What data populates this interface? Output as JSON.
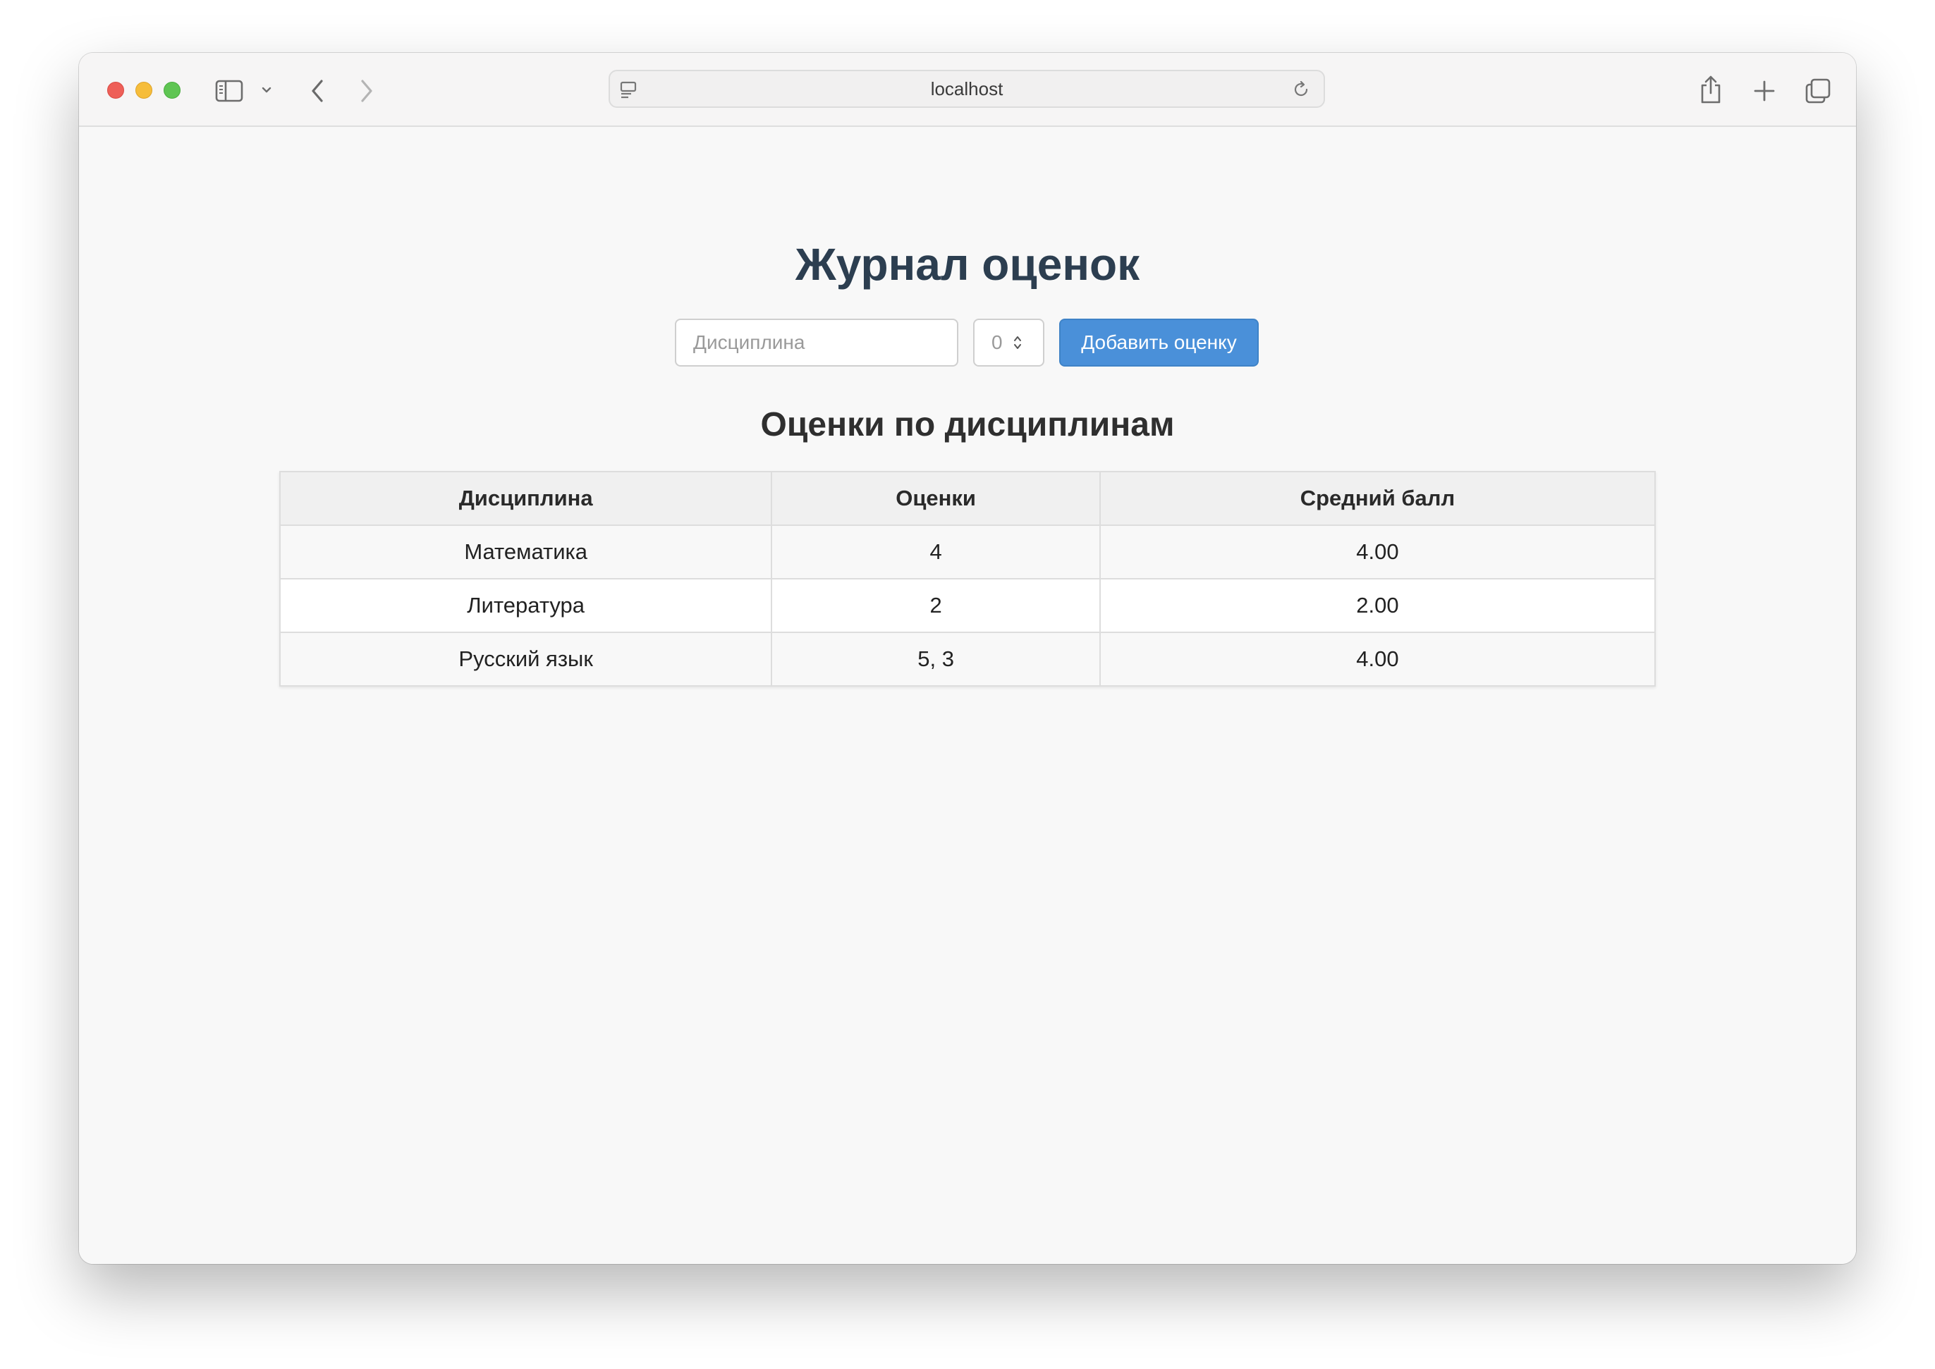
{
  "browser": {
    "address": "localhost"
  },
  "page": {
    "title": "Журнал оценок",
    "form": {
      "subject_placeholder": "Дисциплина",
      "grade_value": "0",
      "add_button_label": "Добавить оценку"
    },
    "section_title": "Оценки по дисциплинам",
    "table": {
      "headers": [
        "Дисциплина",
        "Оценки",
        "Средний балл"
      ],
      "rows": [
        {
          "subject": "Математика",
          "grades": "4",
          "average": "4.00"
        },
        {
          "subject": "Литература",
          "grades": "2",
          "average": "2.00"
        },
        {
          "subject": "Русский язык",
          "grades": "5, 3",
          "average": "4.00"
        }
      ]
    }
  },
  "icons": {
    "sidebar": "sidebar-icon",
    "chevron": "chevron-down-icon",
    "back": "back-arrow-icon",
    "forward": "forward-arrow-icon",
    "site": "page-settings-icon",
    "reload": "reload-icon",
    "share": "share-icon",
    "new_tab": "plus-icon",
    "tabs": "tabs-overview-icon"
  }
}
